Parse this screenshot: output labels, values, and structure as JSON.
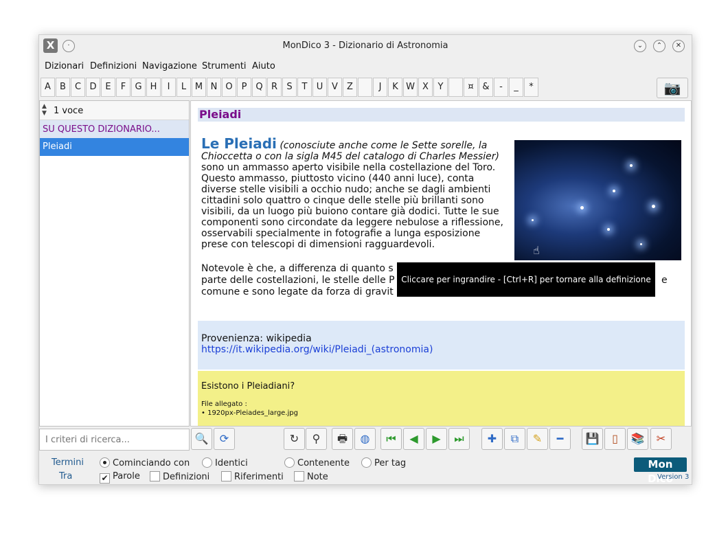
{
  "window": {
    "title": "MonDico 3 - Dizionario di Astronomia"
  },
  "menu": [
    "Dizionari",
    "Definizioni",
    "Navigazione",
    "Strumenti",
    "Aiuto"
  ],
  "letters": [
    "A",
    "B",
    "C",
    "D",
    "E",
    "F",
    "G",
    "H",
    "I",
    "L",
    "M",
    "N",
    "O",
    "P",
    "Q",
    "R",
    "S",
    "T",
    "U",
    "V",
    "Z",
    "",
    "J",
    "K",
    "W",
    "X",
    "Y",
    "",
    "¤",
    "&",
    "-",
    "_",
    "*"
  ],
  "left": {
    "count": "1 voce",
    "header_item": "SU QUESTO DIZIONARIO...",
    "selected_item": "Pleiadi"
  },
  "entry": {
    "heading": "Pleiadi",
    "title": "Le Pleiadi",
    "aka": "(conosciute anche come le Sette sorelle, la Chioccetta o con la sigla M45 del catalogo di Charles Messier)",
    "p1": "sono un ammasso aperto visibile nella costellazione del Toro. Questo ammasso, piuttosto vicino (440 anni luce), conta diverse stelle visibili a occhio nudo; anche se dagli ambienti cittadini solo quattro o cinque delle stelle più brillanti sono visibili, da un luogo più buiono contare già dodici. Tutte le sue componenti sono circondate da leggere nebulose a riflessione, osservabili specialmente in fotografie a lunga esposizione prese con telescopi di dimensioni ragguardevoli.",
    "p2_a": "Notevole è che, a differenza di quanto s",
    "p2_b": "parte delle costellazioni, le stelle delle P",
    "p2_b_end": "e",
    "p2_c": "comune e sono legate da forza di gravit",
    "tooltip": "Cliccare per ingrandire - [Ctrl+R] per tornare alla definizione",
    "source_label": "Provenienza: wikipedia",
    "source_url": "https://it.wikipedia.org/wiki/Pleiadi_(astronomia)",
    "note_title": "Esistono i Pleiadiani?",
    "attach_label": "File allegato :",
    "attach_file": "• 1920px-Pleiades_large.jpg"
  },
  "search": {
    "placeholder": "I criteri di ricerca..."
  },
  "options": {
    "termini_label": "Termini",
    "tra_label": "Tra",
    "radio": [
      "Cominciando con",
      "Identici",
      "Contenente",
      "Per tag"
    ],
    "checks": [
      "Parole",
      "Definizioni",
      "Riferimenti",
      "Note"
    ]
  },
  "logo": {
    "text": "Mon Dico",
    "version": "Version 3"
  }
}
